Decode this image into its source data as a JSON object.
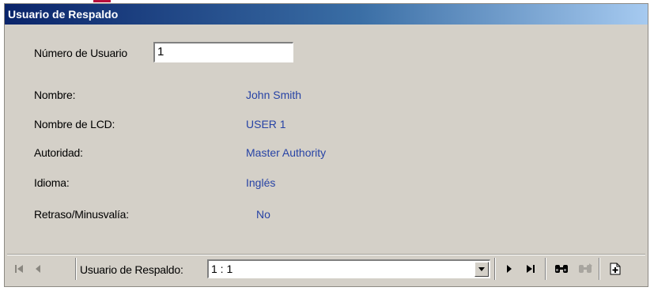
{
  "window": {
    "title": "Usuario de Respaldo"
  },
  "form": {
    "user_number_label": "Número de Usuario",
    "user_number_value": "1",
    "fields": [
      {
        "label": "Nombre:",
        "value": "John Smith"
      },
      {
        "label": "Nombre de LCD:",
        "value": "USER 1"
      },
      {
        "label": "Autoridad:",
        "value": "Master Authority"
      },
      {
        "label": "Idioma:",
        "value": "Inglés"
      },
      {
        "label": "Retraso/Minusvalía:",
        "value": "No"
      }
    ]
  },
  "navbar": {
    "record_label": "Usuario de Respaldo:",
    "record_value": "1 : 1",
    "icons": [
      "first-record-icon",
      "previous-record-icon",
      "dropdown-arrow-icon",
      "next-record-icon",
      "last-record-icon",
      "find-icon",
      "find-next-icon",
      "new-record-icon"
    ]
  },
  "colors": {
    "title_gradient_start": "#0a246a",
    "title_gradient_end": "#a6caf0",
    "value_text": "#2743a5",
    "panel": "#d4d0c8"
  }
}
